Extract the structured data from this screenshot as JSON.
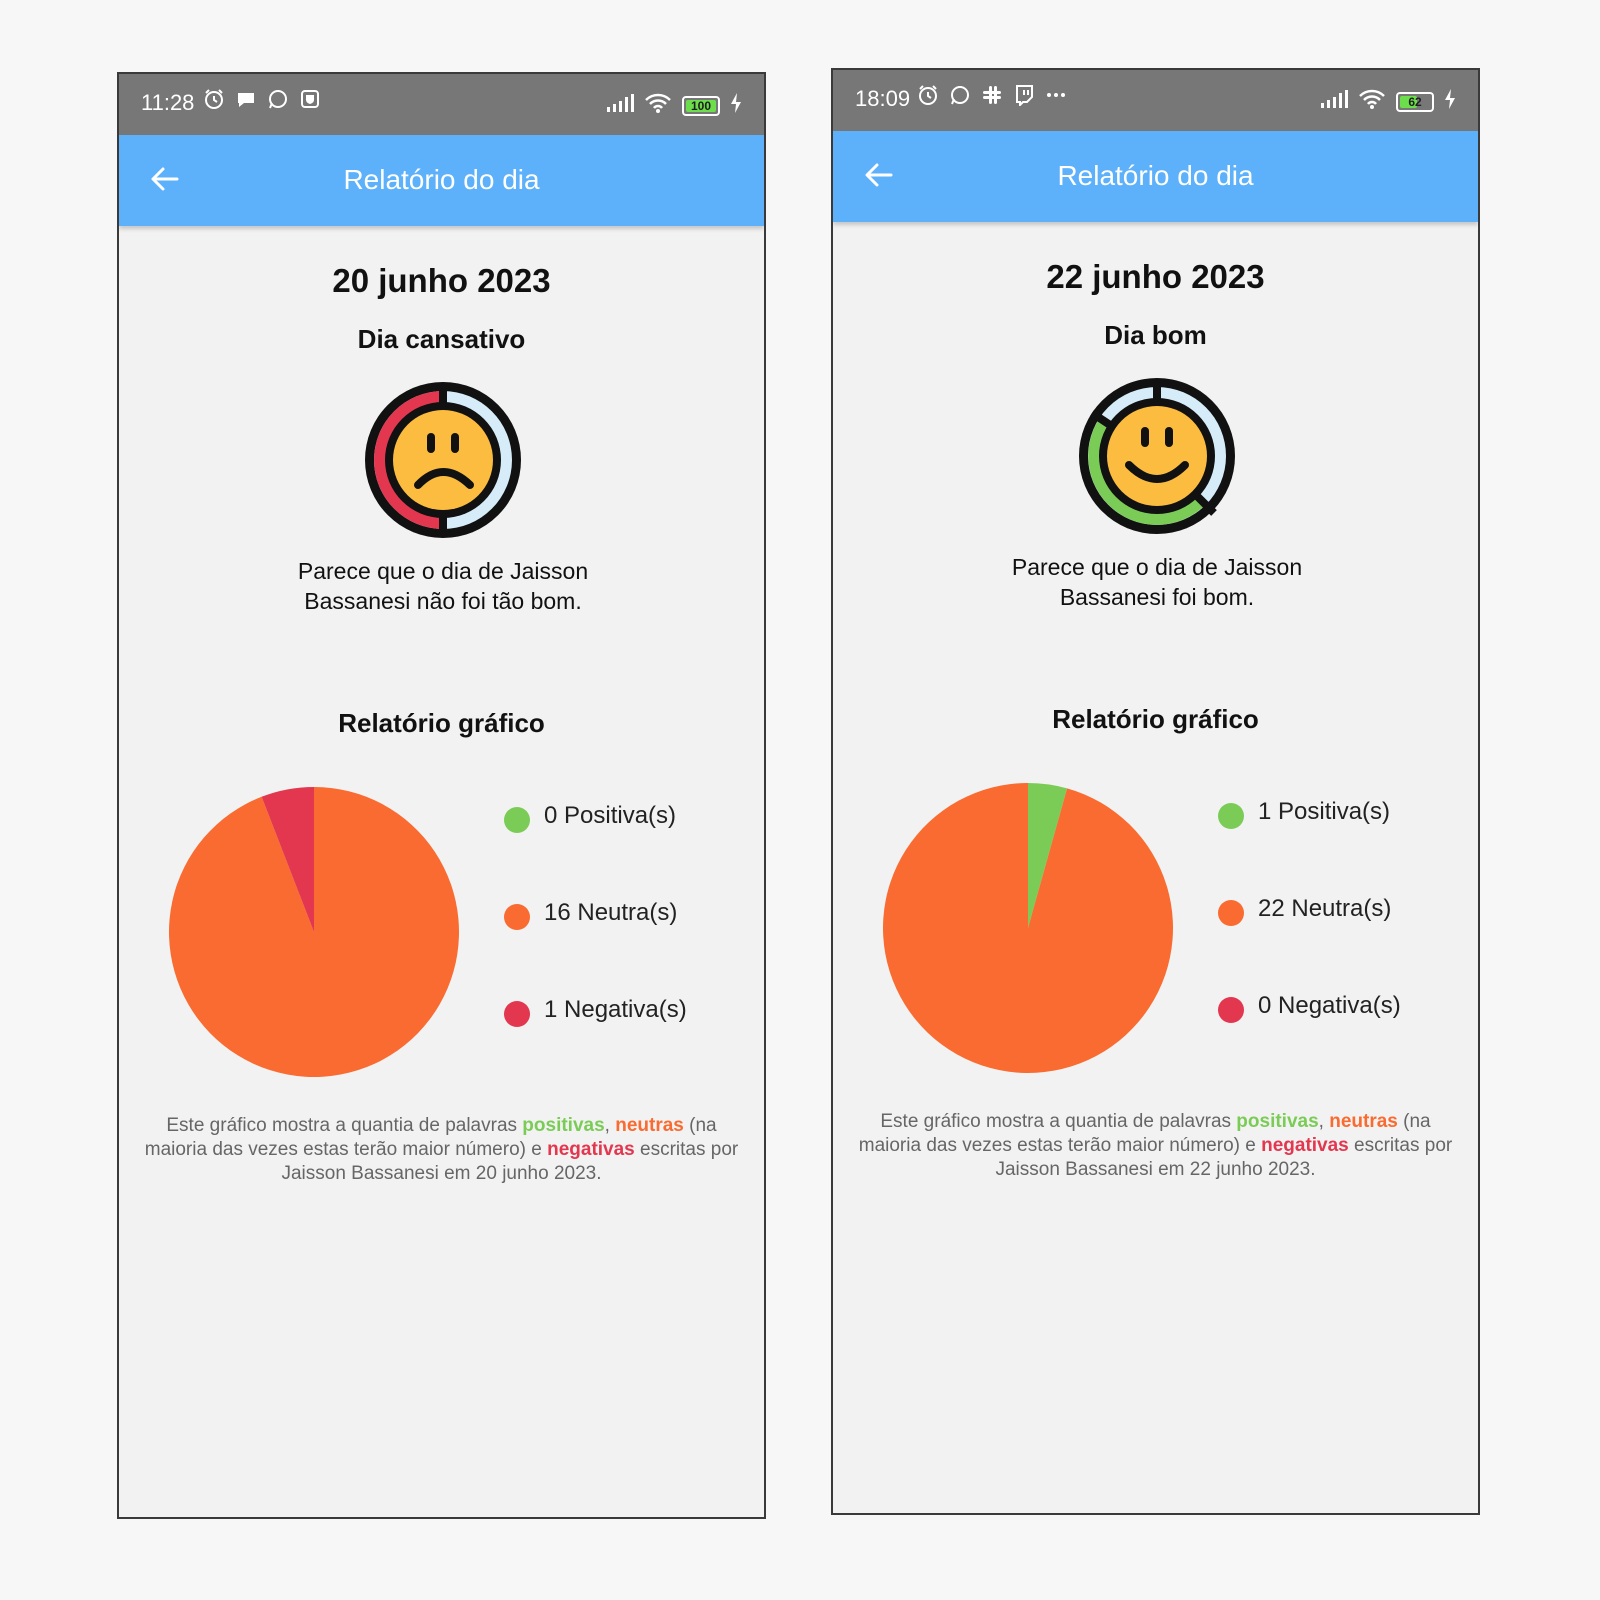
{
  "colors": {
    "positive": "#7bcc57",
    "neutral": "#f96b30",
    "negative": "#e3374f",
    "appbar": "#5db0fa",
    "statusbar": "#777777"
  },
  "screens": [
    {
      "status": {
        "time": "11:28",
        "battery": "100",
        "battery_level": 1.0,
        "left_icons": [
          "alarm-icon",
          "chat-bubble-icon",
          "whatsapp-icon",
          "shield-icon"
        ]
      },
      "appbar": {
        "title": "Relatório do dia",
        "back_icon": "arrow-left-icon"
      },
      "date": "20 junho 2023",
      "mood": {
        "title": "Dia cansativo",
        "icon": "sad-face-icon",
        "text": "Parece que o dia de Jaisson Bassanesi não foi tão bom."
      },
      "graph_title": "Relatório gráfico",
      "legend": {
        "positive": "0 Positiva(s)",
        "neutral": "16 Neutra(s)",
        "negative": "1 Negativa(s)"
      },
      "caption": {
        "part1": "Este gráfico mostra a quantia de palavras ",
        "positive_word": "positivas",
        "sep": ", ",
        "neutral_word": "neutras",
        "part2": " (na maioria das vezes estas terão maior número) e ",
        "negative_word": "negativas",
        "part3": " escritas por Jaisson Bassanesi em 20 junho 2023."
      }
    },
    {
      "status": {
        "time": "18:09",
        "battery": "62",
        "battery_level": 0.62,
        "left_icons": [
          "alarm-icon",
          "whatsapp-icon",
          "slack-icon",
          "twitch-icon",
          "more-dots-icon"
        ]
      },
      "appbar": {
        "title": "Relatório do dia",
        "back_icon": "arrow-left-icon"
      },
      "date": "22 junho 2023",
      "mood": {
        "title": "Dia bom",
        "icon": "happy-face-icon",
        "text": "Parece que o dia de Jaisson Bassanesi foi bom."
      },
      "graph_title": "Relatório gráfico",
      "legend": {
        "positive": "1 Positiva(s)",
        "neutral": "22 Neutra(s)",
        "negative": "0 Negativa(s)"
      },
      "caption": {
        "part1": "Este gráfico mostra a quantia de palavras ",
        "positive_word": "positivas",
        "sep": ", ",
        "neutral_word": "neutras",
        "part2": " (na maioria das vezes estas terão maior número) e ",
        "negative_word": "negativas",
        "part3": " escritas por Jaisson Bassanesi em 22 junho 2023."
      }
    }
  ],
  "chart_data": [
    {
      "type": "pie",
      "categories": [
        "Positiva(s)",
        "Neutra(s)",
        "Negativa(s)"
      ],
      "values": [
        0,
        16,
        1
      ],
      "colors": [
        "#7bcc57",
        "#f96b30",
        "#e3374f"
      ]
    },
    {
      "type": "pie",
      "categories": [
        "Positiva(s)",
        "Neutra(s)",
        "Negativa(s)"
      ],
      "values": [
        1,
        22,
        0
      ],
      "colors": [
        "#7bcc57",
        "#f96b30",
        "#e3374f"
      ]
    }
  ]
}
